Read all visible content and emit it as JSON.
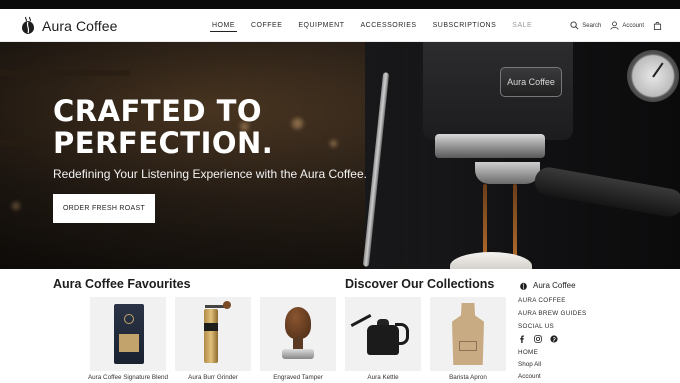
{
  "header": {
    "brand": "Aura Coffee",
    "nav": [
      {
        "label": "HOME",
        "active": true
      },
      {
        "label": "COFFEE"
      },
      {
        "label": "EQUIPMENT"
      },
      {
        "label": "ACCESSORIES"
      },
      {
        "label": "SUBSCRIPTIONS"
      },
      {
        "label": "SALE",
        "muted": true
      }
    ],
    "search_label": "Search",
    "account_label": "Account"
  },
  "hero": {
    "title": "CRAFTED TO PERFECTION.",
    "subtitle": "Redefining Your Listening Experience with the Aura Coffee.",
    "cta_label": "ORDER FRESH ROAST",
    "machine_badge": "Aura Coffee"
  },
  "favourites": {
    "title": "Aura Coffee Favourites",
    "products": [
      {
        "name": "Aura Coffee Signature Blend",
        "icon": "coffee-bag"
      },
      {
        "name": "Aura Burr Grinder",
        "icon": "grinder"
      }
    ]
  },
  "collections": {
    "title": "Discover Our Collections",
    "products": [
      {
        "name": "Engraved Tamper",
        "icon": "tamper"
      },
      {
        "name": "Aura Kettle",
        "icon": "kettle"
      },
      {
        "name": "Barista Apron",
        "icon": "apron"
      }
    ]
  },
  "footer_sidebar": {
    "brand": "Aura Coffee",
    "links": [
      "AURA COFFEE",
      "AURA BREW GUIDES",
      "SOCIAL US"
    ],
    "social": [
      "facebook-icon",
      "instagram-icon",
      "pinterest-icon"
    ],
    "home_label": "HOME",
    "shop_label": "Shop All",
    "account_label": "Account"
  },
  "colors": {
    "accent": "#1d1d1d",
    "cta_bg": "#ffffff",
    "muted_nav": "#9a9a9a"
  }
}
